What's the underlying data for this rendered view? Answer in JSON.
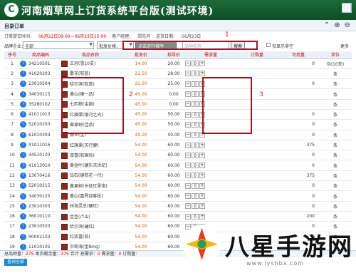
{
  "window": {
    "title": "河南烟草网上订货系统平台版(测试环境)"
  },
  "section": {
    "title": "目录订单"
  },
  "info": {
    "label1": "订单提交时间：",
    "time": "06月22日09:00—06月23日15:00",
    "label2": "客户经理：",
    "manager": "郑先月",
    "label3": "送货日期：",
    "delivery": "06月23日"
  },
  "filter": {
    "label": "品牌企业：",
    "value": "全部",
    "price_value": "批发价格：",
    "sort_btn": "点击进行排序",
    "search_placeholder": "品种名称",
    "search_btn": "搜索",
    "only_label": "仅显示非空",
    "more": "更多"
  },
  "annotations": {
    "a1": "1",
    "a2": "2",
    "a3": "3"
  },
  "columns": [
    "序号",
    "商品编码",
    "商品名称",
    "批发价",
    "指导价",
    "需求量",
    "订购量",
    "可用量",
    "单位"
  ],
  "rows": [
    {
      "no": "1",
      "code": "34210501",
      "name": "王冠(雪10支)",
      "price": "14.00",
      "limit": "20.00",
      "avail": "0",
      "unit": "包(10支)"
    },
    {
      "no": "2",
      "code": "41020203",
      "name": "散花(软蓝)",
      "price": "22.50",
      "limit": "28.00",
      "avail": "",
      "unit": "条"
    },
    {
      "no": "3",
      "code": "23010504",
      "name": "哈尔滨(软蓝)",
      "price": "22.50",
      "limit": "25.00",
      "avail": "0",
      "unit": "条"
    },
    {
      "no": "4",
      "code": "34030115",
      "name": "黄山(硬一品)",
      "price": "45.00",
      "limit": "0.00",
      "avail": "",
      "unit": "条"
    },
    {
      "no": "5",
      "code": "35260102",
      "name": "七匹狼(金银)",
      "price": "45.00",
      "limit": "0.00",
      "avail": "",
      "unit": "条"
    },
    {
      "no": "6",
      "code": "41011013",
      "name": "红旗渠(银河之光)",
      "price": "45.00",
      "limit": "50.00",
      "avail": "0",
      "unit": "条"
    },
    {
      "no": "7",
      "code": "52010203",
      "name": "黄果树(佳品)",
      "price": "45.00",
      "limit": "50.00",
      "avail": "0",
      "unit": "条"
    },
    {
      "no": "8",
      "code": "61010304",
      "name": "猴王(金)",
      "price": "45.00",
      "limit": "50.00",
      "avail": "0",
      "unit": "条"
    },
    {
      "no": "9",
      "code": "41011016",
      "name": "红旗渠(天行健)",
      "price": "54.00",
      "limit": "60.00",
      "avail": "375",
      "unit": "条"
    },
    {
      "no": "10",
      "code": "44510103",
      "name": "双喜(软国际)",
      "price": "54.00",
      "limit": "60.00",
      "avail": "0",
      "unit": "条"
    },
    {
      "no": "11",
      "code": "41013010",
      "name": "黄金叶(硬乐天世纪)",
      "price": "54.00",
      "limit": "60.00",
      "avail": "0",
      "unit": "条"
    },
    {
      "no": "12",
      "code": "13070416",
      "name": "钻石(硬荷花一代)",
      "price": "54.00",
      "limit": "60.00",
      "avail": "375",
      "unit": "条"
    },
    {
      "no": "13",
      "code": "52010215",
      "name": "黄果树(长征红星炮)",
      "price": "54.00",
      "limit": "60.00",
      "avail": "0",
      "unit": "条"
    },
    {
      "no": "14",
      "code": "34030125",
      "name": "黄山(嘉界迎客松)",
      "price": "54.00",
      "limit": "60.00",
      "avail": "0",
      "unit": "条"
    },
    {
      "no": "15",
      "code": "23010303",
      "name": "林海灵芝(硬红)",
      "price": "54.00",
      "limit": "60.00",
      "avail": "0",
      "unit": "条"
    },
    {
      "no": "16",
      "code": "36010110",
      "name": "金圣(卢山)",
      "price": "54.00",
      "limit": "60.00",
      "avail": "200",
      "unit": "条"
    },
    {
      "no": "17",
      "code": "23010503",
      "name": "哈尔滨(硬红)",
      "price": "54.00",
      "limit": "60.00",
      "avail": "0",
      "unit": "条"
    },
    {
      "no": "18",
      "code": "90002103",
      "name": "红双喜(软)",
      "price": "54.00",
      "limit": "60.00",
      "avail": "0",
      "unit": "条"
    },
    {
      "no": "19",
      "code": "11010105",
      "name": "中南海(金8mg)",
      "price": "54.00",
      "limit": "60.00",
      "avail": "",
      "unit": "条"
    }
  ],
  "stepper": {
    "minus": "−",
    "plus": "+",
    "value": "0"
  },
  "footer": {
    "total_label": "总品种量：",
    "total": "275",
    "remain_label": "本页剩余量：",
    "remain": "375",
    "sum_label": "合计 总需求：",
    "sum": "0",
    "demand_label": "需求量：",
    "demand": "0",
    "order_label": "订购量："
  },
  "query_btn": "查询全部",
  "watermark": {
    "text": "八星手游网",
    "url": "www.lyshbx.com"
  }
}
